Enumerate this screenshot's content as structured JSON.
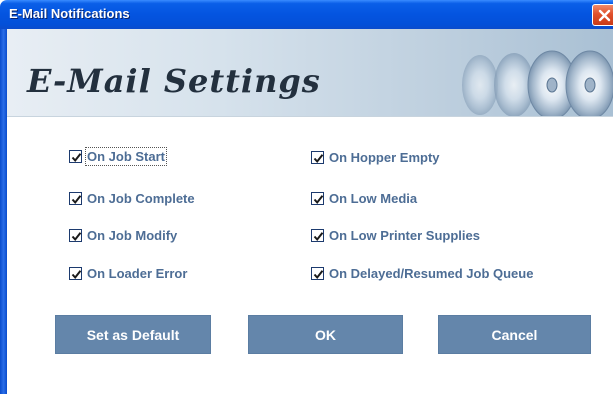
{
  "window": {
    "title": "E-Mail Notifications"
  },
  "banner": {
    "title": "E-Mail Settings"
  },
  "options": {
    "left": [
      {
        "label": "On Job Start",
        "checked": true
      },
      {
        "label": "On Job Complete",
        "checked": true
      },
      {
        "label": "On Job Modify",
        "checked": true
      },
      {
        "label": "On Loader Error",
        "checked": true
      }
    ],
    "right": [
      {
        "label": "On Hopper Empty",
        "checked": true
      },
      {
        "label": "On Low Media",
        "checked": true
      },
      {
        "label": "On Low Printer Supplies",
        "checked": true
      },
      {
        "label": "On Delayed/Resumed Job Queue",
        "checked": true
      }
    ]
  },
  "buttons": {
    "set_default": "Set as Default",
    "ok": "OK",
    "cancel": "Cancel"
  },
  "colors": {
    "title_bar": "#0454e0",
    "label_text": "#4d6d95",
    "button_bg": "#6486ab"
  }
}
